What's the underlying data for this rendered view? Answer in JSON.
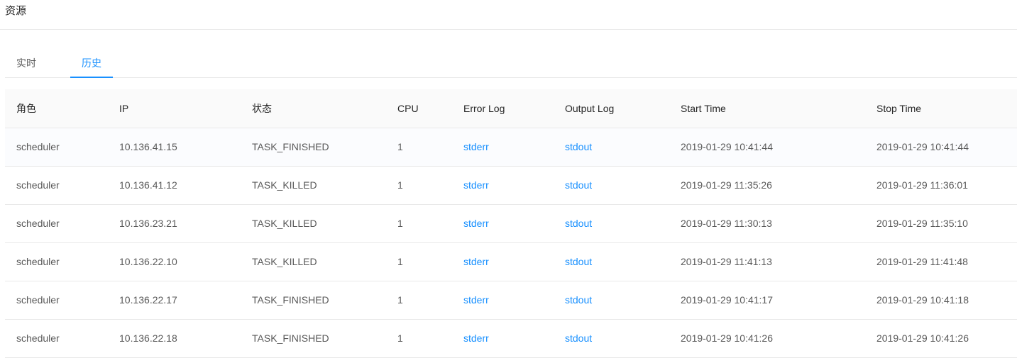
{
  "header": {
    "title": "资源"
  },
  "tabs": [
    {
      "label": "实时",
      "active": false
    },
    {
      "label": "历史",
      "active": true
    }
  ],
  "table": {
    "columns": [
      "角色",
      "IP",
      "状态",
      "CPU",
      "Error Log",
      "Output Log",
      "Start Time",
      "Stop Time"
    ],
    "rows": [
      {
        "role": "scheduler",
        "ip": "10.136.41.15",
        "status": "TASK_FINISHED",
        "cpu": "1",
        "error_log": "stderr",
        "output_log": "stdout",
        "start": "2019-01-29 10:41:44",
        "stop": "2019-01-29 10:41:44"
      },
      {
        "role": "scheduler",
        "ip": "10.136.41.12",
        "status": "TASK_KILLED",
        "cpu": "1",
        "error_log": "stderr",
        "output_log": "stdout",
        "start": "2019-01-29 11:35:26",
        "stop": "2019-01-29 11:36:01"
      },
      {
        "role": "scheduler",
        "ip": "10.136.23.21",
        "status": "TASK_KILLED",
        "cpu": "1",
        "error_log": "stderr",
        "output_log": "stdout",
        "start": "2019-01-29 11:30:13",
        "stop": "2019-01-29 11:35:10"
      },
      {
        "role": "scheduler",
        "ip": "10.136.22.10",
        "status": "TASK_KILLED",
        "cpu": "1",
        "error_log": "stderr",
        "output_log": "stdout",
        "start": "2019-01-29 11:41:13",
        "stop": "2019-01-29 11:41:48"
      },
      {
        "role": "scheduler",
        "ip": "10.136.22.17",
        "status": "TASK_FINISHED",
        "cpu": "1",
        "error_log": "stderr",
        "output_log": "stdout",
        "start": "2019-01-29 10:41:17",
        "stop": "2019-01-29 10:41:18"
      },
      {
        "role": "scheduler",
        "ip": "10.136.22.18",
        "status": "TASK_FINISHED",
        "cpu": "1",
        "error_log": "stderr",
        "output_log": "stdout",
        "start": "2019-01-29 10:41:26",
        "stop": "2019-01-29 10:41:26"
      }
    ]
  },
  "colors": {
    "accent": "#1890ff",
    "border": "#e8e8e8",
    "header_bg": "#fafafa"
  }
}
